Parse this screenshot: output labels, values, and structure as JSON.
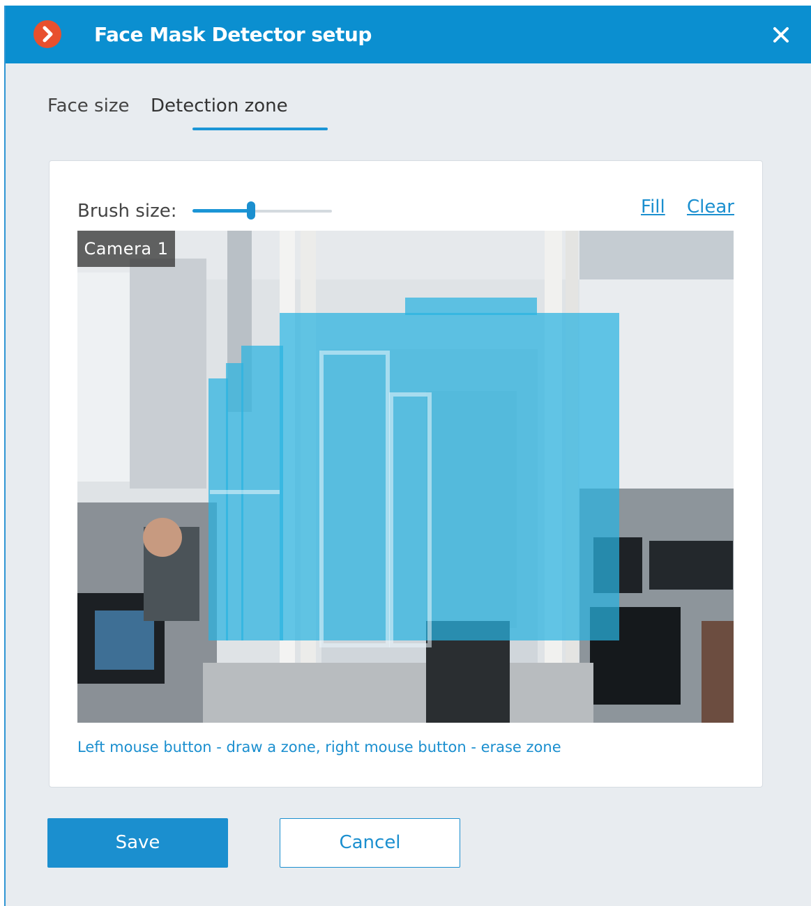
{
  "window": {
    "title": "Face Mask Detector setup"
  },
  "tabs": [
    {
      "label": "Face size",
      "active": false
    },
    {
      "label": "Detection zone",
      "active": true
    }
  ],
  "toolbar": {
    "brush_label": "Brush size:",
    "brush_level": 0.42,
    "fill_label": "Fill",
    "clear_label": "Clear"
  },
  "camera": {
    "name": "Camera 1"
  },
  "hint": "Left mouse button - draw a zone, right mouse button - erase zone",
  "buttons": {
    "save": "Save",
    "cancel": "Cancel"
  },
  "colors": {
    "accent": "#1b8fcf",
    "titlebar": "#0b8fd0",
    "logo": "#e8502e",
    "zone": "#29b3e0"
  }
}
